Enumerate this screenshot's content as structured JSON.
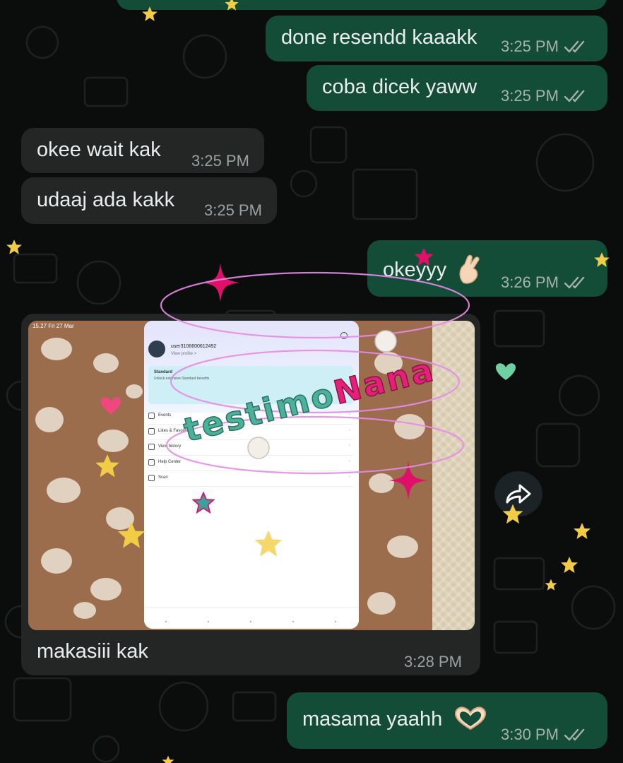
{
  "messages": [
    {
      "text": "done resendd kaaakk",
      "time": "3:25 PM",
      "direction": "out",
      "status": "read"
    },
    {
      "text": "coba dicek yaww",
      "time": "3:25 PM",
      "direction": "out",
      "status": "read"
    },
    {
      "text": "okee wait kak",
      "time": "3:25 PM",
      "direction": "in"
    },
    {
      "text": "udaaj ada kakk",
      "time": "3:25 PM",
      "direction": "in"
    },
    {
      "text": "okeyyy",
      "emoji": "crossed-fingers-icon",
      "time": "3:26 PM",
      "direction": "out",
      "status": "read"
    },
    {
      "text": "makasiii kak",
      "time": "3:28 PM",
      "direction": "in",
      "has_image": true
    },
    {
      "text": "masama yaahh",
      "emoji": "heart-hands-icon",
      "time": "3:30 PM",
      "direction": "out",
      "status": "read"
    }
  ],
  "image_attachment": {
    "watermark": "testimoNana",
    "tablet_status": "15.27  Fri 27 Mar",
    "app_screen": {
      "username": "user3106600612492",
      "view_profile": "View profile >",
      "plan": "Standard",
      "plan_sub": "Unlock extensive Standard benefits",
      "menu_items": [
        "Events",
        "Likes & Favorites",
        "View history",
        "Help Center",
        "Scan"
      ]
    }
  },
  "forward_button": {
    "icon": "forward-icon"
  },
  "colors": {
    "background": "#0b0d0c",
    "outgoing_bubble": "#144d37",
    "incoming_bubble": "#242626",
    "text": "#e9edef",
    "timestamp": "#a4b3ad",
    "sticker_pink": "#e0106a",
    "sticker_gold": "#f2cc45",
    "watermark_teal": "#4bb19a",
    "watermark_pink": "#e6207a"
  }
}
